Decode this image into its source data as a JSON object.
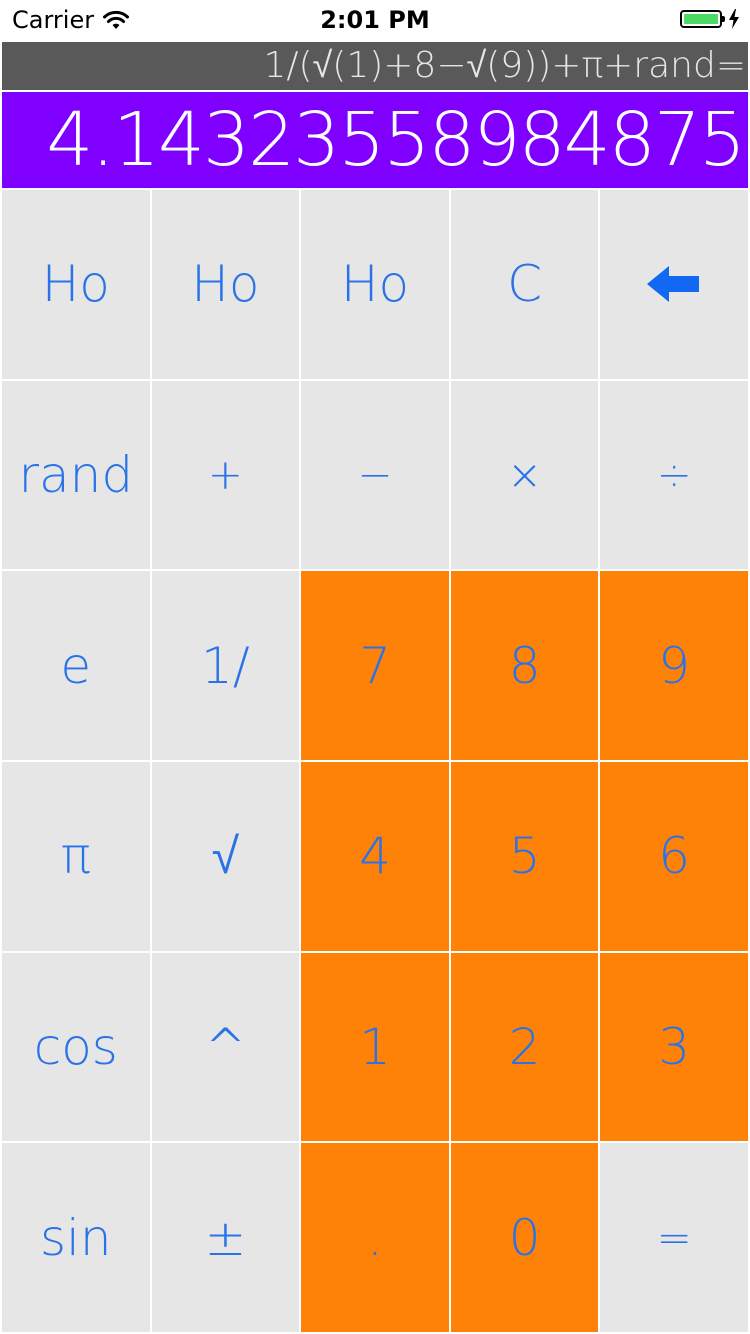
{
  "status_bar": {
    "carrier": "Carrier",
    "time": "2:01 PM",
    "icons": [
      "wifi-icon",
      "battery-icon",
      "charging-bolt-icon"
    ]
  },
  "display": {
    "expression": "1/(√(1)+8−√(9))+π+rand=",
    "result": "4.1432355898487​5"
  },
  "colors": {
    "accent_text": "#2a72e8",
    "key_gray": "#e6e6e6",
    "key_orange": "#ff8208",
    "result_bg": "#8000ff",
    "expression_bg": "#595959"
  },
  "keys": {
    "r1": [
      "Ho",
      "Ho",
      "Ho",
      "C",
      "back-arrow-icon"
    ],
    "r2": [
      "rand",
      "+",
      "−",
      "×",
      "÷"
    ],
    "r3": [
      "e",
      "1/",
      "7",
      "8",
      "9"
    ],
    "r4": [
      "π",
      "√",
      "4",
      "5",
      "6"
    ],
    "r5": [
      "cos",
      "^",
      "1",
      "2",
      "3"
    ],
    "r6": [
      "sin",
      "±",
      ".",
      "0",
      "="
    ]
  }
}
